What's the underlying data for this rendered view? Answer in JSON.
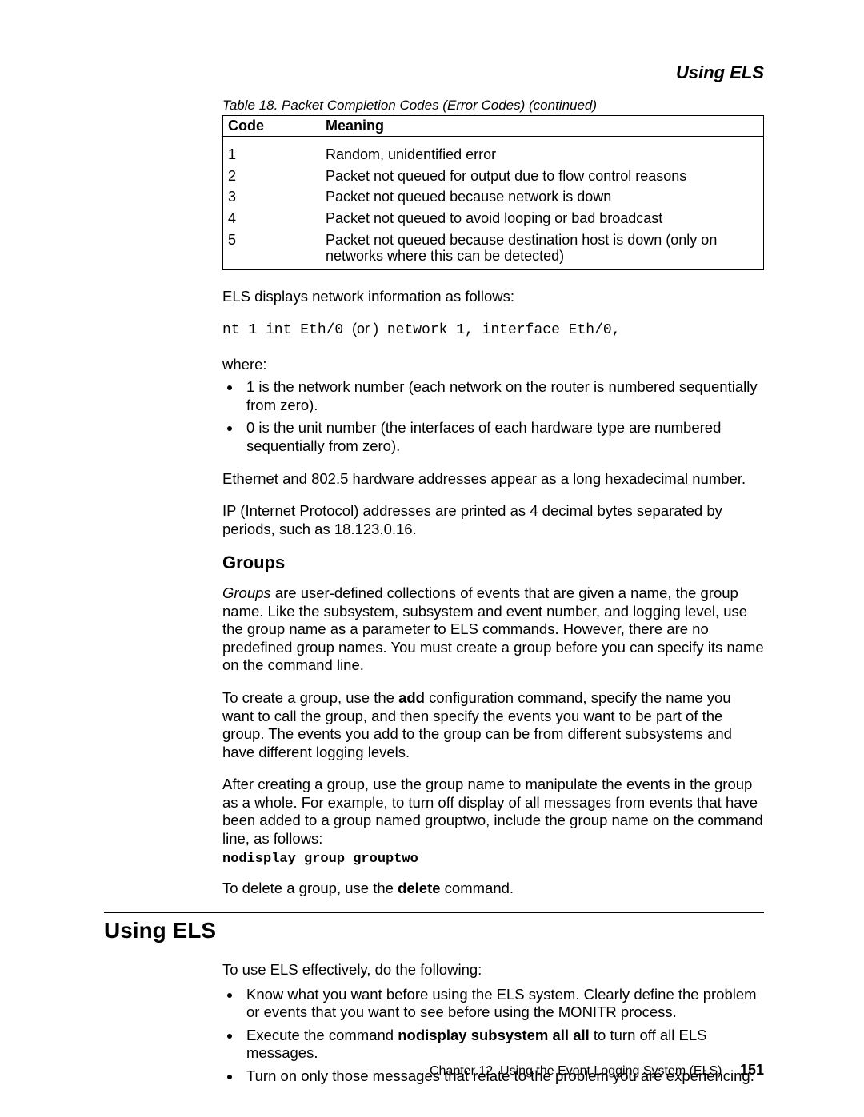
{
  "running_head": "Using ELS",
  "table": {
    "caption": "Table 18. Packet Completion Codes (Error Codes)  (continued)",
    "headers": {
      "code": "Code",
      "meaning": "Meaning"
    },
    "rows": [
      {
        "code": "1",
        "meaning": "Random, unidentified error"
      },
      {
        "code": "2",
        "meaning": "Packet not queued for output due to flow control reasons"
      },
      {
        "code": "3",
        "meaning": "Packet not queued because network is down"
      },
      {
        "code": "4",
        "meaning": "Packet not queued to avoid looping or bad broadcast"
      },
      {
        "code": "5",
        "meaning": "Packet not queued because destination host is down (only on networks where this can be detected)"
      }
    ]
  },
  "p_els_displays": "ELS displays network information as follows:",
  "code_line": {
    "a": "nt 1 int Eth/0 ",
    "or": "(or )",
    "b": " network 1, interface Eth/0,"
  },
  "where_label": "where:",
  "where_items": [
    "1 is the network number (each network on the router is numbered sequentially from zero).",
    "0 is the unit number (the interfaces of each hardware type are numbered sequentially from zero)."
  ],
  "p_ethernet": "Ethernet and 802.5 hardware addresses appear as a long hexadecimal number.",
  "p_ip": "IP (Internet Protocol) addresses are printed as 4 decimal bytes separated by periods, such as 18.123.0.16.",
  "groups": {
    "heading": "Groups",
    "p1_lead": "Groups",
    "p1_rest": " are user-defined collections of events that are given a name, the group name. Like the subsystem, subsystem and event number, and logging level, use the group name as a parameter to ELS commands. However, there are no predefined group names. You must create a group before you can specify its name on the command line.",
    "p2_a": "To create a group, use the ",
    "p2_bold": "add",
    "p2_b": " configuration command, specify the name you want to call the group, and then specify the events you want to be part of the group. The events you add to the group can be from different subsystems and have different logging levels.",
    "p3": "After creating a group, use the group name to manipulate the events in the group as a whole. For example, to turn off display of all messages from events that have been added to a group named grouptwo, include the group name on the command line, as follows:",
    "cmd": "nodisplay group grouptwo",
    "p4_a": "To delete a group, use the ",
    "p4_bold": "delete",
    "p4_b": " command."
  },
  "using_els": {
    "heading": "Using ELS",
    "intro": "To use ELS effectively, do the following:",
    "items": {
      "i1": "Know what you want before using the ELS system. Clearly define the problem or events that you want to see before using the MONITR process.",
      "i2_a": "Execute the command ",
      "i2_bold": "nodisplay subsystem all all",
      "i2_b": " to turn off all ELS messages.",
      "i3": "Turn on only those messages that relate to the problem you are experiencing."
    }
  },
  "footer": {
    "chapter": "Chapter 12. Using the Event Logging System (ELS)",
    "page": "151"
  }
}
